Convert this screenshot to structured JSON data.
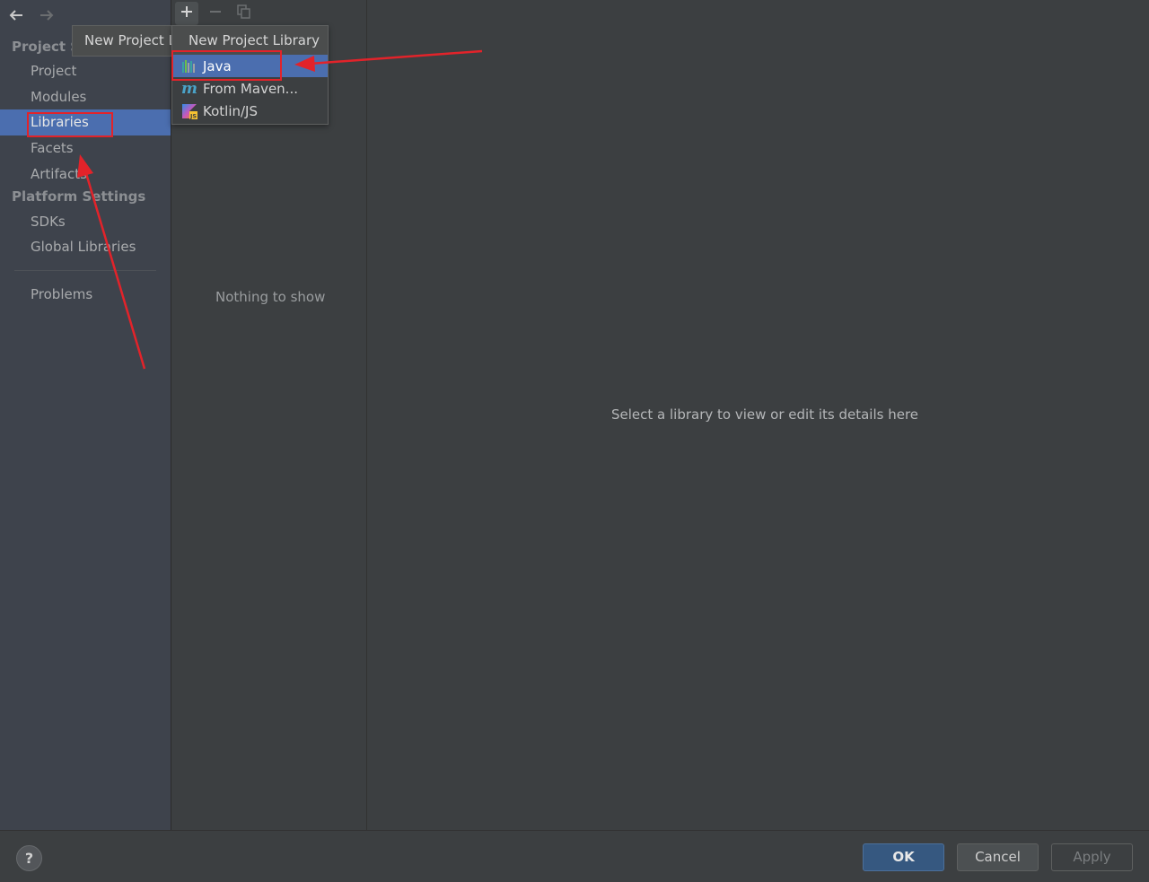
{
  "sidebar": {
    "section_project": "Project S",
    "items_project": [
      {
        "label": "Project"
      },
      {
        "label": "Modules"
      },
      {
        "label": "Libraries"
      },
      {
        "label": "Facets"
      },
      {
        "label": "Artifacts"
      }
    ],
    "section_platform": "Platform Settings",
    "items_platform": [
      {
        "label": "SDKs"
      },
      {
        "label": "Global Libraries"
      }
    ],
    "problems_label": "Problems",
    "selected_item": "Libraries"
  },
  "toolbar": {
    "add_icon": "plus-icon",
    "remove_icon": "minus-icon",
    "copy_icon": "copy-icon"
  },
  "tooltip": {
    "text": "New Project Library"
  },
  "popup": {
    "title": "New Project Library",
    "items": [
      {
        "label": "Java",
        "icon": "java-library-icon"
      },
      {
        "label": "From Maven...",
        "icon": "maven-icon"
      },
      {
        "label": "Kotlin/JS",
        "icon": "kotlin-js-icon"
      }
    ],
    "selected_item": "Java"
  },
  "middle_panel": {
    "empty_text": "Nothing to show"
  },
  "details_panel": {
    "hint": "Select a library to view or edit its details here"
  },
  "buttons": {
    "help_label": "?",
    "ok_label": "OK",
    "cancel_label": "Cancel",
    "apply_label": "Apply"
  },
  "colors": {
    "selection": "#4b6eaf",
    "annotation": "#e2232a",
    "ok_button": "#365880"
  }
}
